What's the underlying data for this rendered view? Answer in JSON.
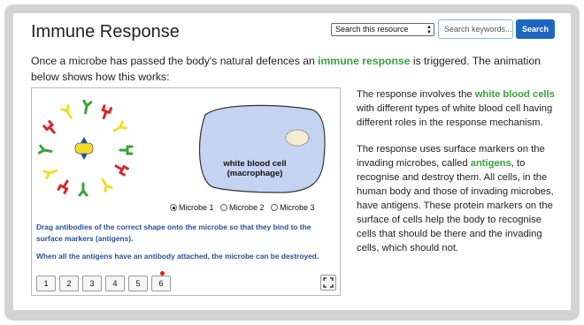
{
  "header": {
    "title": "Immune Response",
    "search_scope": "Search this resource",
    "search_placeholder": "Search keywords...",
    "search_button": "Search"
  },
  "intro": {
    "before": "Once a microbe has passed the body's natural defences an ",
    "link": "immune response",
    "after": " is triggered. The animation below shows how this works:"
  },
  "animation": {
    "cell_label_line1": "white blood cell",
    "cell_label_line2": "(macrophage)",
    "microbe_options": [
      "Microbe 1",
      "Microbe 2",
      "Microbe 3"
    ],
    "selected_microbe": "Microbe 1",
    "instruction1": "Drag antibodies of the correct shape onto the microbe so that they bind to the surface markers (antigens).",
    "instruction2": "When all the antigens have an antibody attached, the microbe can be destroyed.",
    "pages": [
      "1",
      "2",
      "3",
      "4",
      "5",
      "6"
    ],
    "current_page": "6",
    "colors": {
      "red": "#d9262a",
      "yellow": "#f2dc2a",
      "green": "#3aa33a",
      "cell": "#c5d3f2"
    }
  },
  "side": {
    "p1_before": "The response involves the ",
    "p1_link": "white blood cells",
    "p1_after": " with different types of white blood cell having different roles in the response mechanism.",
    "p2_before": "The response uses surface markers on the invading microbes, called ",
    "p2_link": "antigens",
    "p2_after": ", to recognise and destroy them. All cells, in the human body and those of invading microbes, have antigens. These protein markers on the surface of cells help the body to recognise cells that should be there and the invading cells, which should not."
  }
}
